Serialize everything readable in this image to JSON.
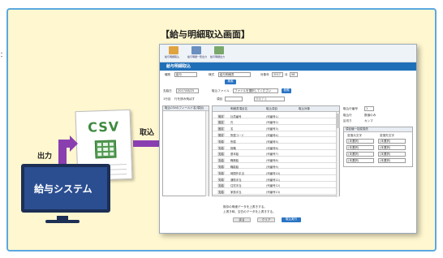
{
  "stray_text": "：",
  "title": "【給与明細取込画面】",
  "diagram": {
    "csv": "CSV",
    "output_label": "出力",
    "import_label": "取込",
    "system_label": "給与システム"
  },
  "screen": {
    "toolbar": [
      {
        "label": "給与明細取込",
        "icon": "import-icon",
        "color": "#e0a340"
      },
      {
        "label": "給与明細一覧出力",
        "icon": "monitor-icon",
        "color": "#6a8fc0"
      },
      {
        "label": "給与明細出力",
        "icon": "printer-icon",
        "color": "#7aa86a"
      }
    ],
    "header_title": "給与明細取込",
    "filters": {
      "kubun_label": "種別",
      "kubun_value": "給与",
      "sentaku_label": "様式",
      "sentaku_value": "給与明細書",
      "nengetsu_label": "対象年",
      "year_value": "2017",
      "month_label": "月",
      "month_value": "08",
      "search_button": "検索"
    },
    "file_row": {
      "date_label": "支給日",
      "date_value": "2017/08/25",
      "file_label": "取込ファイル",
      "file_value": "ファイルを選択してください",
      "browse_button": "参照"
    },
    "option_row": {
      "header_label": "1行目",
      "header_option": "行を読み飛ばす",
      "item_label": "項目",
      "search_placeholder": "検索する"
    },
    "left_panel": {
      "header": "取込CSVのフィールド名(項目)"
    },
    "table": {
      "columns": [
        "明細書項目名",
        "取込項目",
        "取込対象"
      ],
      "rows": [
        {
          "tag": "固定",
          "name": "社員番号",
          "source": "(列番号1)"
        },
        {
          "tag": "固定",
          "name": "氏",
          "source": "(列番号2)"
        },
        {
          "tag": "固定",
          "name": "名",
          "source": "(列番号3)"
        },
        {
          "tag": "固定",
          "name": "所属コード",
          "source": "(列番号4)"
        },
        {
          "tag": "支給",
          "name": "所属",
          "source": "(列番号5)"
        },
        {
          "tag": "支給",
          "name": "役職",
          "source": "(列番号6)"
        },
        {
          "tag": "支給",
          "name": "基本給",
          "source": "(列番号7)"
        },
        {
          "tag": "支給",
          "name": "職務給",
          "source": "(列番号8)"
        },
        {
          "tag": "支給",
          "name": "職能給",
          "source": "(列番号9)"
        },
        {
          "tag": "支給",
          "name": "時間外手当",
          "source": "(列番号10)"
        },
        {
          "tag": "支給",
          "name": "通勤手当",
          "source": "(列番号11)"
        },
        {
          "tag": "支給",
          "name": "住宅手当",
          "source": "(列番号12)"
        },
        {
          "tag": "支給",
          "name": "家族手当",
          "source": "(列番号13)"
        }
      ]
    },
    "right_panel": {
      "row1_label": "取込行番号",
      "row1_value": "1",
      "row2_label": "取込行",
      "row2_opt": "数値のみ",
      "row3_label": "区切り",
      "row3_opt": "カンマ",
      "sub_header": "項目値一括変換先",
      "sub_cols": [
        "変換元文字",
        "変換先文字"
      ],
      "sub_rows": [
        {
          "from": "(未選択)",
          "to": "(未選択)"
        },
        {
          "from": "(未選択)",
          "to": "(未選択)"
        },
        {
          "from": "(未選択)",
          "to": "(未選択)"
        },
        {
          "from": "(未選択)",
          "to": "(未選択)"
        }
      ]
    },
    "footer": {
      "check1": "既存の明細データを上書きする。",
      "check2": "上書き時、空白のデータを上書きする。",
      "btn1": "戻る",
      "btn2": "クリア",
      "btn3": "取込実行"
    }
  }
}
